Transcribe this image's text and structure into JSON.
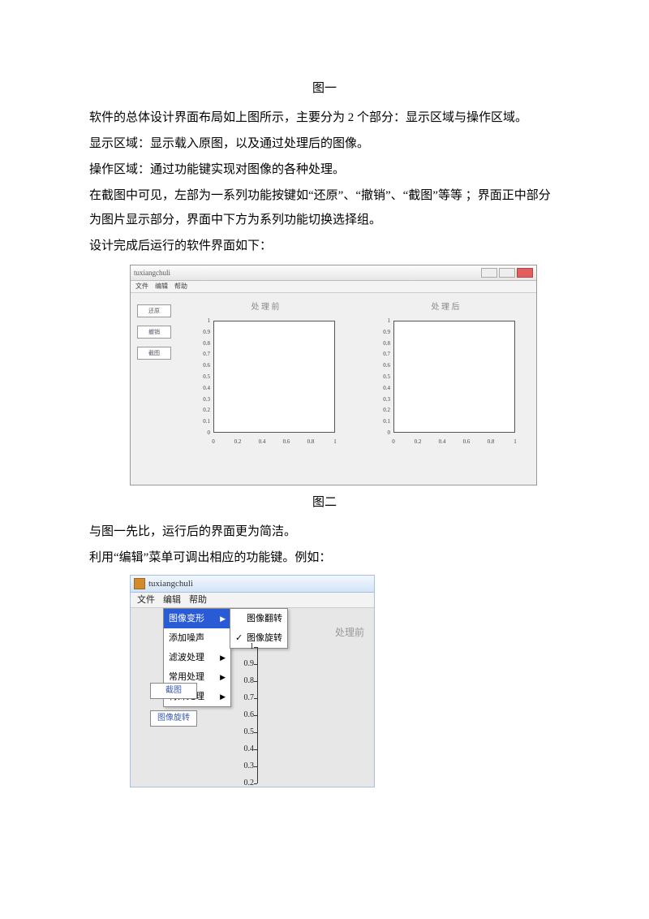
{
  "captions": {
    "fig1": "图一",
    "fig2": "图二"
  },
  "para1": "软件的总体设计界面布局如上图所示，主要分为 2 个部分：显示区域与操作区域。",
  "para2": "显示区域：显示载入原图，以及通过处理后的图像。",
  "para3": "操作区域：通过功能键实现对图像的各种处理。",
  "para4": "在截图中可见，左部为一系列功能按键如“还原”、“撤销”、“截图”等等 ；界面正中部分为图片显示部分，界面中下方为系列功能切换选择组。",
  "para5": "设计完成后运行的软件界面如下：",
  "para6": "与图一先比，运行后的界面更为简洁。",
  "para7": "利用“编辑”菜单可调出相应的功能键。例如：",
  "fig2win": {
    "title": "tuxiangchuli",
    "menus": [
      "文件",
      "编辑",
      "帮助"
    ],
    "sidebtns": [
      "还原",
      "撤销",
      "截图"
    ],
    "plot_titles": {
      "left": "处 理 前",
      "right": "处 理 后"
    },
    "yticks": [
      "1",
      "0.9",
      "0.8",
      "0.7",
      "0.6",
      "0.5",
      "0.4",
      "0.3",
      "0.2",
      "0.1",
      "0"
    ],
    "xticks": [
      "0",
      "0.2",
      "0.4",
      "0.6",
      "0.8",
      "1"
    ]
  },
  "fig3win": {
    "title": "tuxiangchuli",
    "menus": [
      "文件",
      "编辑",
      "帮助"
    ],
    "dropdown": [
      {
        "label": "图像变形",
        "hl": true
      },
      {
        "label": "添加噪声",
        "hl": false
      },
      {
        "label": "滤波处理",
        "hl": false
      },
      {
        "label": "常用处理",
        "hl": false
      },
      {
        "label": "特殊处理",
        "hl": false
      }
    ],
    "submenu": [
      {
        "label": "图像翻转",
        "checked": false
      },
      {
        "label": "图像旋转",
        "checked": true
      }
    ],
    "sidebtns": [
      "截图",
      "图像旋转"
    ],
    "header_right": "处理前",
    "yticks": [
      "1",
      "0.9",
      "0.8",
      "0.7",
      "0.6",
      "0.5",
      "0.4",
      "0.3",
      "0.2"
    ]
  }
}
